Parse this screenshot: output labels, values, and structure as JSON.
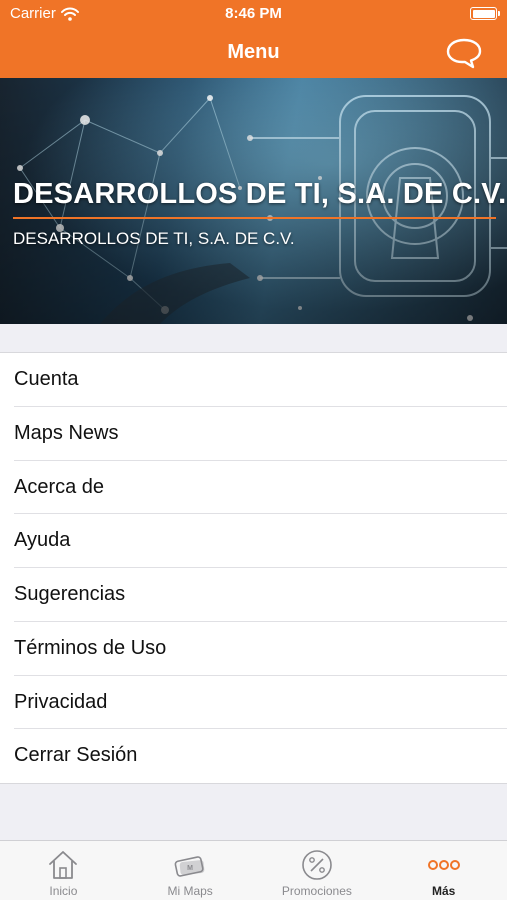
{
  "status_bar": {
    "carrier": "Carrier",
    "time": "8:46 PM"
  },
  "nav_bar": {
    "title": "Menu"
  },
  "banner": {
    "company_name": "DESARROLLOS DE TI, S.A. DE C.V.",
    "company_subtitle": "DESARROLLOS DE TI, S.A. DE C.V."
  },
  "menu": {
    "items": [
      {
        "label": "Cuenta"
      },
      {
        "label": "Maps News"
      },
      {
        "label": "Acerca de"
      },
      {
        "label": "Ayuda"
      },
      {
        "label": "Sugerencias"
      },
      {
        "label": "Términos de Uso"
      },
      {
        "label": "Privacidad"
      },
      {
        "label": "Cerrar Sesión"
      }
    ]
  },
  "tab_bar": {
    "tabs": [
      {
        "label": "Inicio",
        "icon": "home-icon",
        "active": false
      },
      {
        "label": "Mi Maps",
        "icon": "card-icon",
        "active": false
      },
      {
        "label": "Promociones",
        "icon": "percent-icon",
        "active": false
      },
      {
        "label": "Más",
        "icon": "more-icon",
        "active": true
      }
    ]
  },
  "colors": {
    "accent": "#f07427",
    "background": "#efeff4"
  }
}
